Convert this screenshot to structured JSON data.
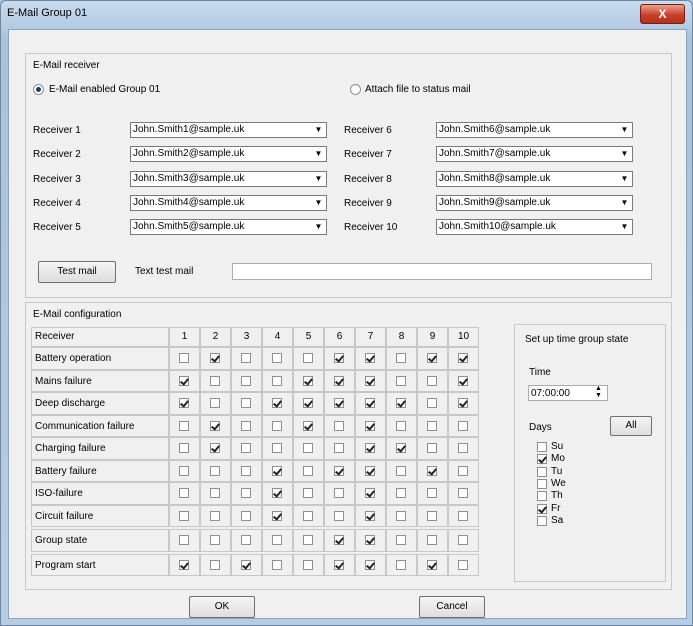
{
  "window": {
    "title": "E-Mail Group 01",
    "close_glyph": "X"
  },
  "receiver_section": {
    "title": "E-Mail receiver",
    "enabled_label": "E-Mail enabled Group 01",
    "attach_label": "Attach file to status mail",
    "receivers": [
      {
        "label": "Receiver 1",
        "value": "John.Smith1@sample.uk"
      },
      {
        "label": "Receiver 2",
        "value": "John.Smith2@sample.uk"
      },
      {
        "label": "Receiver 3",
        "value": "John.Smith3@sample.uk"
      },
      {
        "label": "Receiver 4",
        "value": "John.Smith4@sample.uk"
      },
      {
        "label": "Receiver 5",
        "value": "John.Smith5@sample.uk"
      },
      {
        "label": "Receiver 6",
        "value": "John.Smith6@sample.uk"
      },
      {
        "label": "Receiver 7",
        "value": "John.Smith7@sample.uk"
      },
      {
        "label": "Receiver 8",
        "value": "John.Smith8@sample.uk"
      },
      {
        "label": "Receiver 9",
        "value": "John.Smith9@sample.uk"
      },
      {
        "label": "Receiver 10",
        "value": "John.Smith10@sample.uk"
      }
    ],
    "test_button": "Test mail",
    "test_text_label": "Text test mail",
    "test_text_value": ""
  },
  "config": {
    "title": "E-Mail configuration",
    "header_label": "Receiver",
    "columns": [
      "1",
      "2",
      "3",
      "4",
      "5",
      "6",
      "7",
      "8",
      "9",
      "10"
    ],
    "rows": [
      {
        "label": "Battery operation",
        "checks": [
          0,
          1,
          0,
          0,
          0,
          1,
          1,
          0,
          1,
          1
        ]
      },
      {
        "label": "Mains failure",
        "checks": [
          1,
          0,
          0,
          0,
          1,
          1,
          1,
          0,
          0,
          1
        ]
      },
      {
        "label": "Deep discharge",
        "checks": [
          1,
          0,
          0,
          1,
          1,
          1,
          1,
          1,
          0,
          1
        ]
      },
      {
        "label": "Communication failure",
        "checks": [
          0,
          1,
          0,
          0,
          1,
          0,
          1,
          0,
          0,
          0
        ]
      },
      {
        "label": "Charging failure",
        "checks": [
          0,
          1,
          0,
          0,
          0,
          0,
          1,
          1,
          0,
          0
        ]
      },
      {
        "label": "Battery failure",
        "checks": [
          0,
          0,
          0,
          1,
          0,
          1,
          1,
          0,
          1,
          0
        ]
      },
      {
        "label": "ISO-failure",
        "checks": [
          0,
          0,
          0,
          1,
          0,
          0,
          1,
          0,
          0,
          0
        ]
      },
      {
        "label": "Circuit failure",
        "checks": [
          0,
          0,
          0,
          1,
          0,
          0,
          1,
          0,
          0,
          0
        ]
      },
      {
        "label": "Group state",
        "checks": [
          0,
          0,
          0,
          0,
          0,
          1,
          1,
          0,
          0,
          0
        ]
      },
      {
        "label": "Program start",
        "checks": [
          1,
          0,
          1,
          0,
          0,
          1,
          1,
          0,
          1,
          0
        ]
      }
    ]
  },
  "time_panel": {
    "title": "Set up time group state",
    "time_label": "Time",
    "time_value": "07:00:00",
    "days_label": "Days",
    "all_button": "All",
    "days": [
      {
        "label": "Su",
        "checked": false
      },
      {
        "label": "Mo",
        "checked": true
      },
      {
        "label": "Tu",
        "checked": false
      },
      {
        "label": "We",
        "checked": false
      },
      {
        "label": "Th",
        "checked": false
      },
      {
        "label": "Fr",
        "checked": true
      },
      {
        "label": "Sa",
        "checked": false
      }
    ]
  },
  "footer": {
    "ok": "OK",
    "cancel": "Cancel"
  }
}
